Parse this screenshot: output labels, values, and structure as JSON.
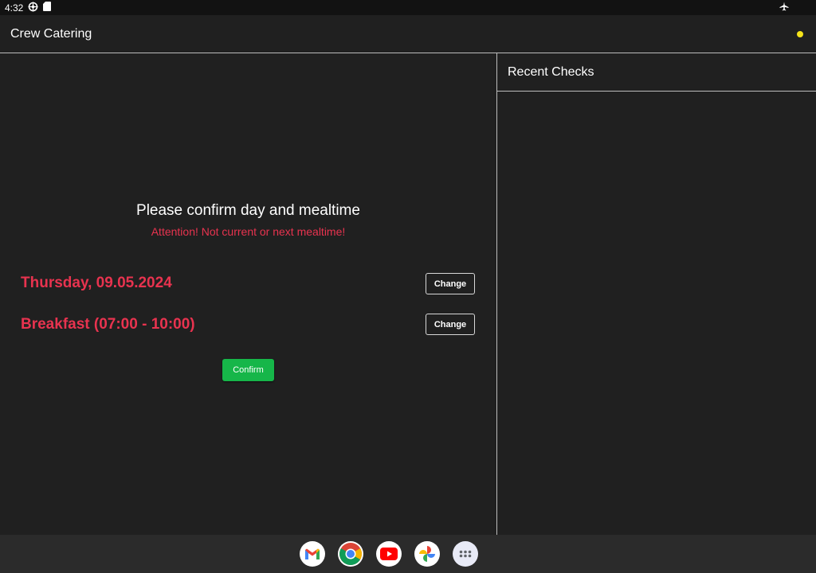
{
  "status_bar": {
    "time": "4:32",
    "icons": [
      "settings-status-icon",
      "sd-card-icon",
      "airplane-mode-icon"
    ]
  },
  "app_bar": {
    "title": "Crew Catering",
    "indicator_color": "#f5e31a"
  },
  "main": {
    "prompt": "Please confirm day and mealtime",
    "warning": "Attention! Not current or next mealtime!",
    "date_label": "Thursday, 09.05.2024",
    "meal_label": "Breakfast (07:00 - 10:00)",
    "change_label": "Change",
    "confirm_label": "Confirm",
    "accent_color": "#e8334f",
    "confirm_color": "#16b649"
  },
  "side_panel": {
    "title": "Recent Checks"
  },
  "dock": {
    "apps": [
      "gmail-icon",
      "chrome-icon",
      "youtube-icon",
      "photos-icon",
      "app-drawer-icon"
    ]
  }
}
